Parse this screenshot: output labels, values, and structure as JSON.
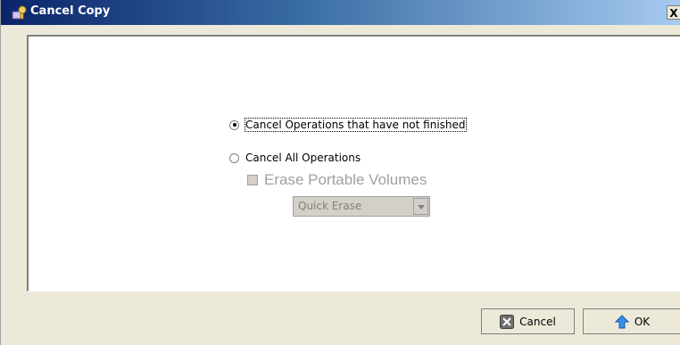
{
  "window": {
    "title": "Cancel Copy",
    "close_label": "X"
  },
  "options": {
    "cancel_unfinished_label": "Cancel Operations that have not finished",
    "cancel_unfinished_selected": true,
    "cancel_all_label": "Cancel All Operations",
    "cancel_all_selected": false,
    "erase_portable_label": "Erase Portable Volumes",
    "erase_portable_checked": false,
    "erase_portable_enabled": false,
    "erase_method_value": "Quick Erase",
    "erase_method_enabled": false
  },
  "buttons": {
    "cancel_label": "Cancel",
    "ok_label": "OK"
  },
  "icons": {
    "title": "copy-icon",
    "cancel": "cancel-x-icon",
    "ok": "up-arrow-icon"
  }
}
